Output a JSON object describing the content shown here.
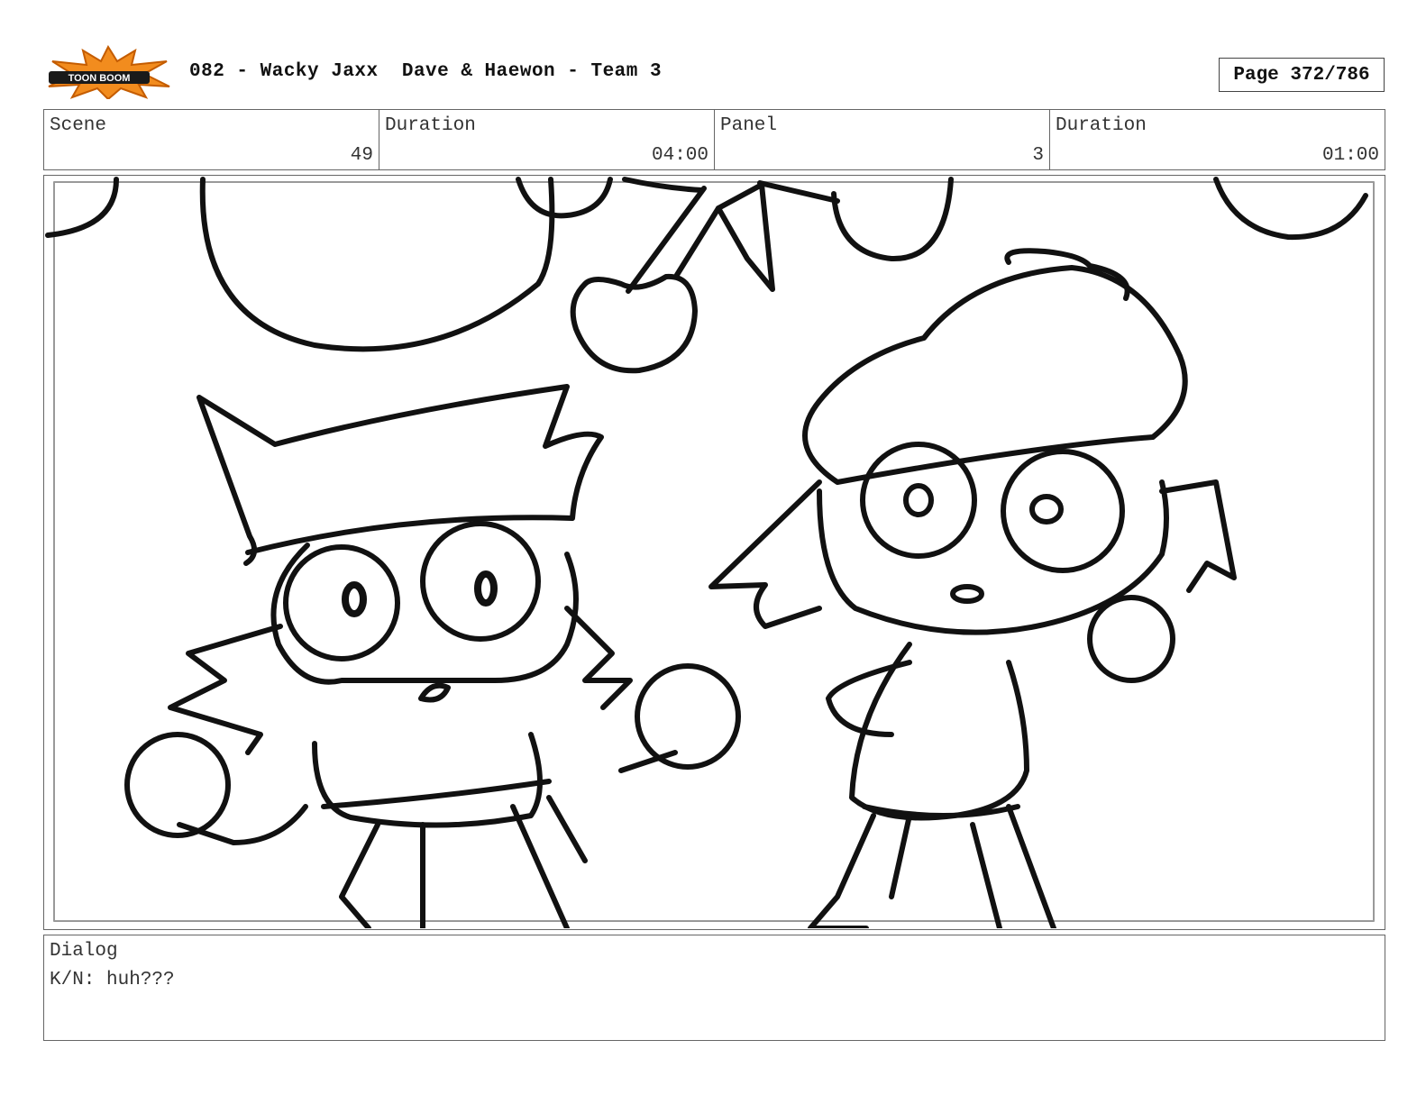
{
  "header": {
    "logo_text": "TOON BOOM",
    "title": "082 - Wacky Jaxx  Dave & Haewon - Team 3",
    "page": "Page 372/786"
  },
  "info": {
    "scene_label": "Scene",
    "scene_value": "49",
    "scene_duration_label": "Duration",
    "scene_duration_value": "04:00",
    "panel_label": "Panel",
    "panel_value": "3",
    "panel_duration_label": "Duration",
    "panel_duration_value": "01:00"
  },
  "dialog": {
    "label": "Dialog",
    "text": "K/N: huh???"
  },
  "colors": {
    "logo_orange": "#f28c1e",
    "logo_dark": "#1a1a1a",
    "border": "#666666"
  }
}
